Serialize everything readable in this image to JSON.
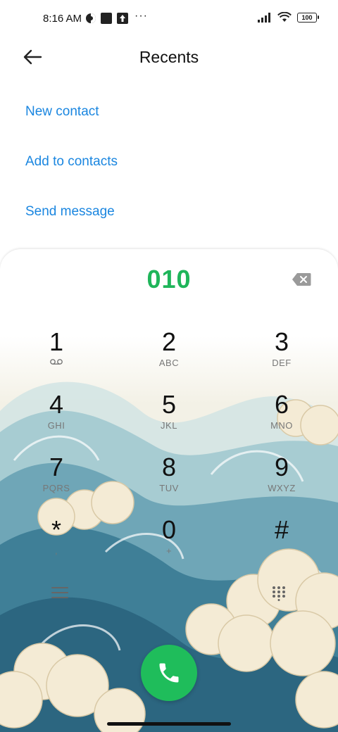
{
  "status_bar": {
    "time": "8:16 AM",
    "dots": "···",
    "battery": "100"
  },
  "header": {
    "title": "Recents",
    "back_icon": "arrow-left-icon"
  },
  "actions": [
    {
      "label": "New contact"
    },
    {
      "label": "Add to contacts"
    },
    {
      "label": "Send message"
    }
  ],
  "dialer": {
    "number": "010",
    "number_color": "#1fb55a",
    "backspace_icon": "backspace-icon",
    "keys": [
      {
        "digit": "1",
        "letters": ""
      },
      {
        "digit": "2",
        "letters": "ABC"
      },
      {
        "digit": "3",
        "letters": "DEF"
      },
      {
        "digit": "4",
        "letters": "GHI"
      },
      {
        "digit": "5",
        "letters": "JKL"
      },
      {
        "digit": "6",
        "letters": "MNO"
      },
      {
        "digit": "7",
        "letters": "PQRS"
      },
      {
        "digit": "8",
        "letters": "TUV"
      },
      {
        "digit": "9",
        "letters": "WXYZ"
      },
      {
        "digit": "*",
        "letters": ","
      },
      {
        "digit": "0",
        "letters": "+"
      },
      {
        "digit": "#",
        "letters": ""
      }
    ],
    "call_color": "#1fbd5b",
    "menu_icon": "menu-icon",
    "keypad_icon": "keypad-grid-icon",
    "call_icon": "phone-icon"
  },
  "colors": {
    "accent_link": "#1a86e0"
  }
}
